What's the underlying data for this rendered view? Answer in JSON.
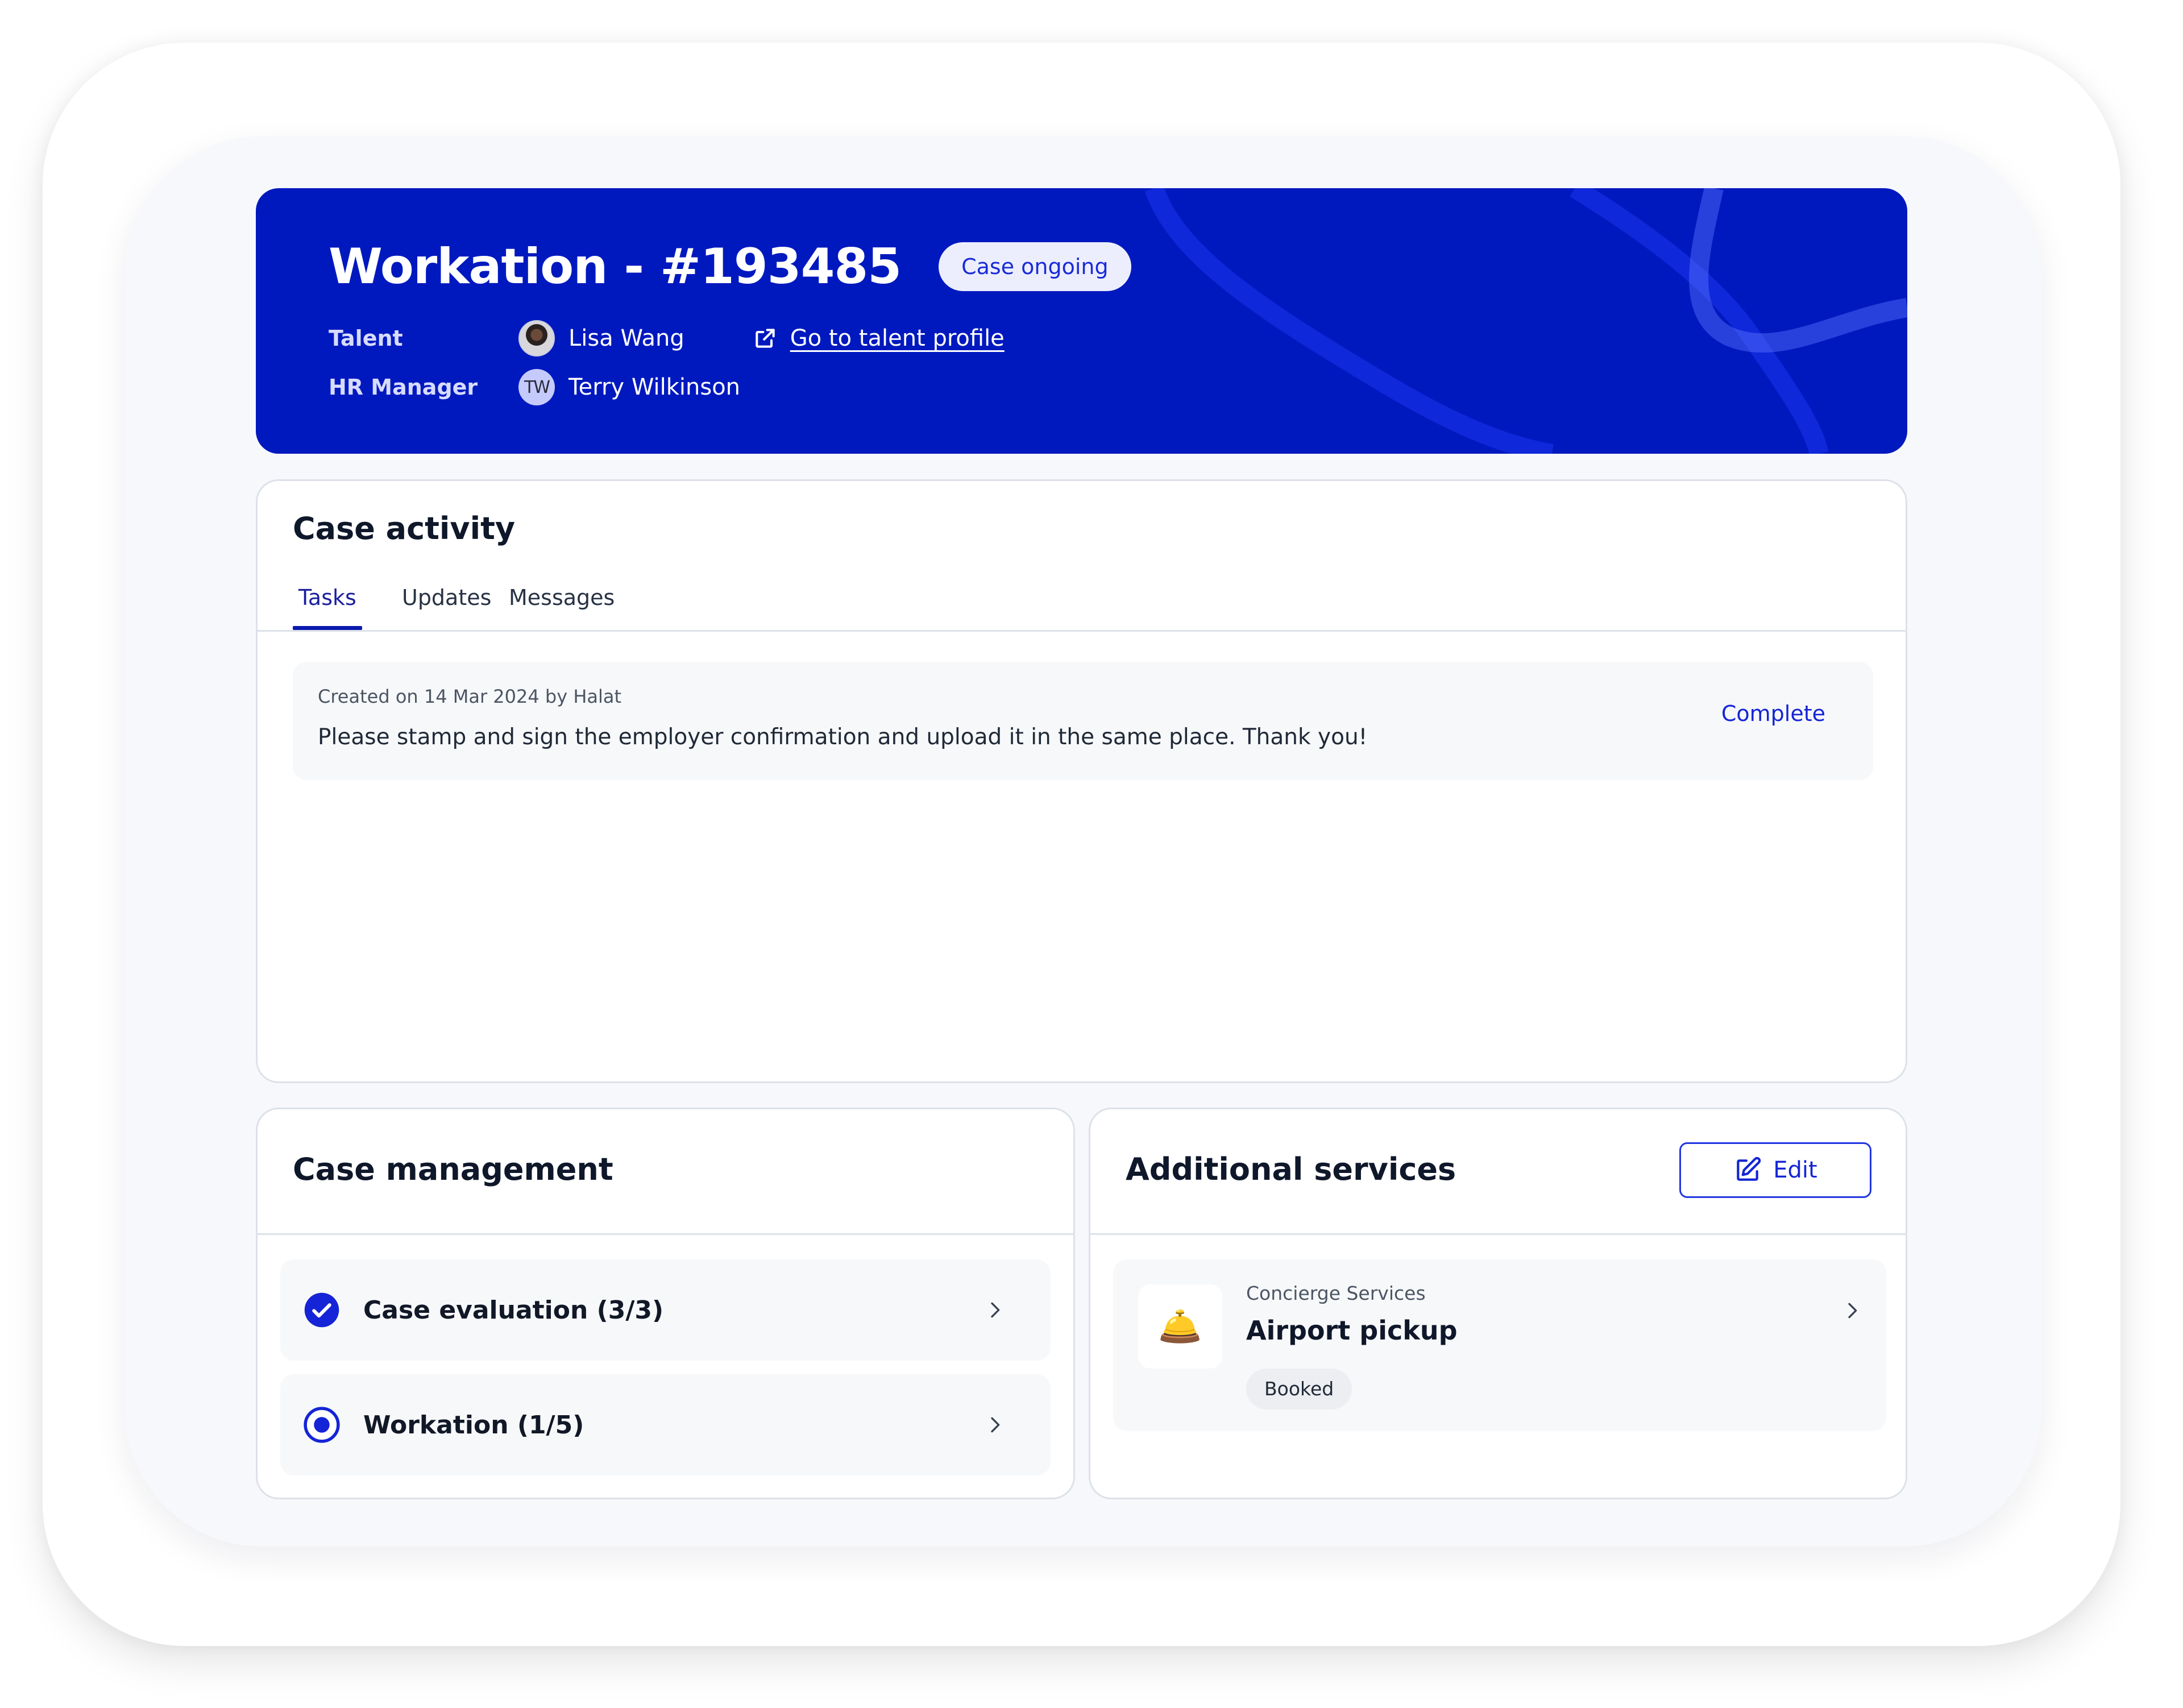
{
  "header": {
    "title": "Workation - #193485",
    "status": "Case ongoing",
    "talent_label": "Talent",
    "talent_name": "Lisa Wang",
    "profile_link": "Go to talent profile",
    "hr_label": "HR Manager",
    "hr_initials": "TW",
    "hr_name": "Terry Wilkinson",
    "colors": {
      "background": "#0019BF",
      "status_pill_bg": "#ECEEFE",
      "status_pill_text": "#1A2BD6"
    }
  },
  "case_activity": {
    "title": "Case activity",
    "tabs": [
      {
        "label": "Tasks",
        "active": true
      },
      {
        "label": "Updates",
        "active": false
      },
      {
        "label": "Messages",
        "active": false
      }
    ],
    "tasks": [
      {
        "meta": "Created on 14 Mar 2024 by Halat",
        "text": "Please stamp and sign the employer confirmation and upload it in the same place. Thank you!",
        "action": "Complete"
      }
    ]
  },
  "case_management": {
    "title": "Case management",
    "items": [
      {
        "label": "Case evaluation (3/3)",
        "status": "completed",
        "icon": "check-circle-icon"
      },
      {
        "label": "Workation (1/5)",
        "status": "in-progress",
        "icon": "radio-dot-icon"
      }
    ]
  },
  "additional_services": {
    "title": "Additional services",
    "edit_label": "Edit",
    "items": [
      {
        "category": "Concierge Services",
        "name": "Airport pickup",
        "badge": "Booked",
        "icon": "bellhop-bell-icon",
        "emoji": "🛎️"
      }
    ]
  },
  "accent_color": "#1424D6"
}
